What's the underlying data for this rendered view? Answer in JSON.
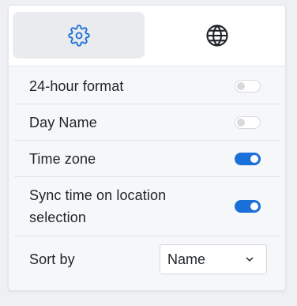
{
  "tabs": [
    {
      "icon": "gear-icon",
      "active": true
    },
    {
      "icon": "globe-icon",
      "active": false
    }
  ],
  "settings": [
    {
      "label": "24-hour format",
      "enabled": false
    },
    {
      "label": "Day Name",
      "enabled": false
    },
    {
      "label": "Time zone",
      "enabled": true
    },
    {
      "label": "Sync time on location selection",
      "enabled": true
    }
  ],
  "sort": {
    "label": "Sort by",
    "value": "Name"
  },
  "colors": {
    "accent": "#1a6fd8",
    "toggle_off": "#d7d9dd"
  }
}
